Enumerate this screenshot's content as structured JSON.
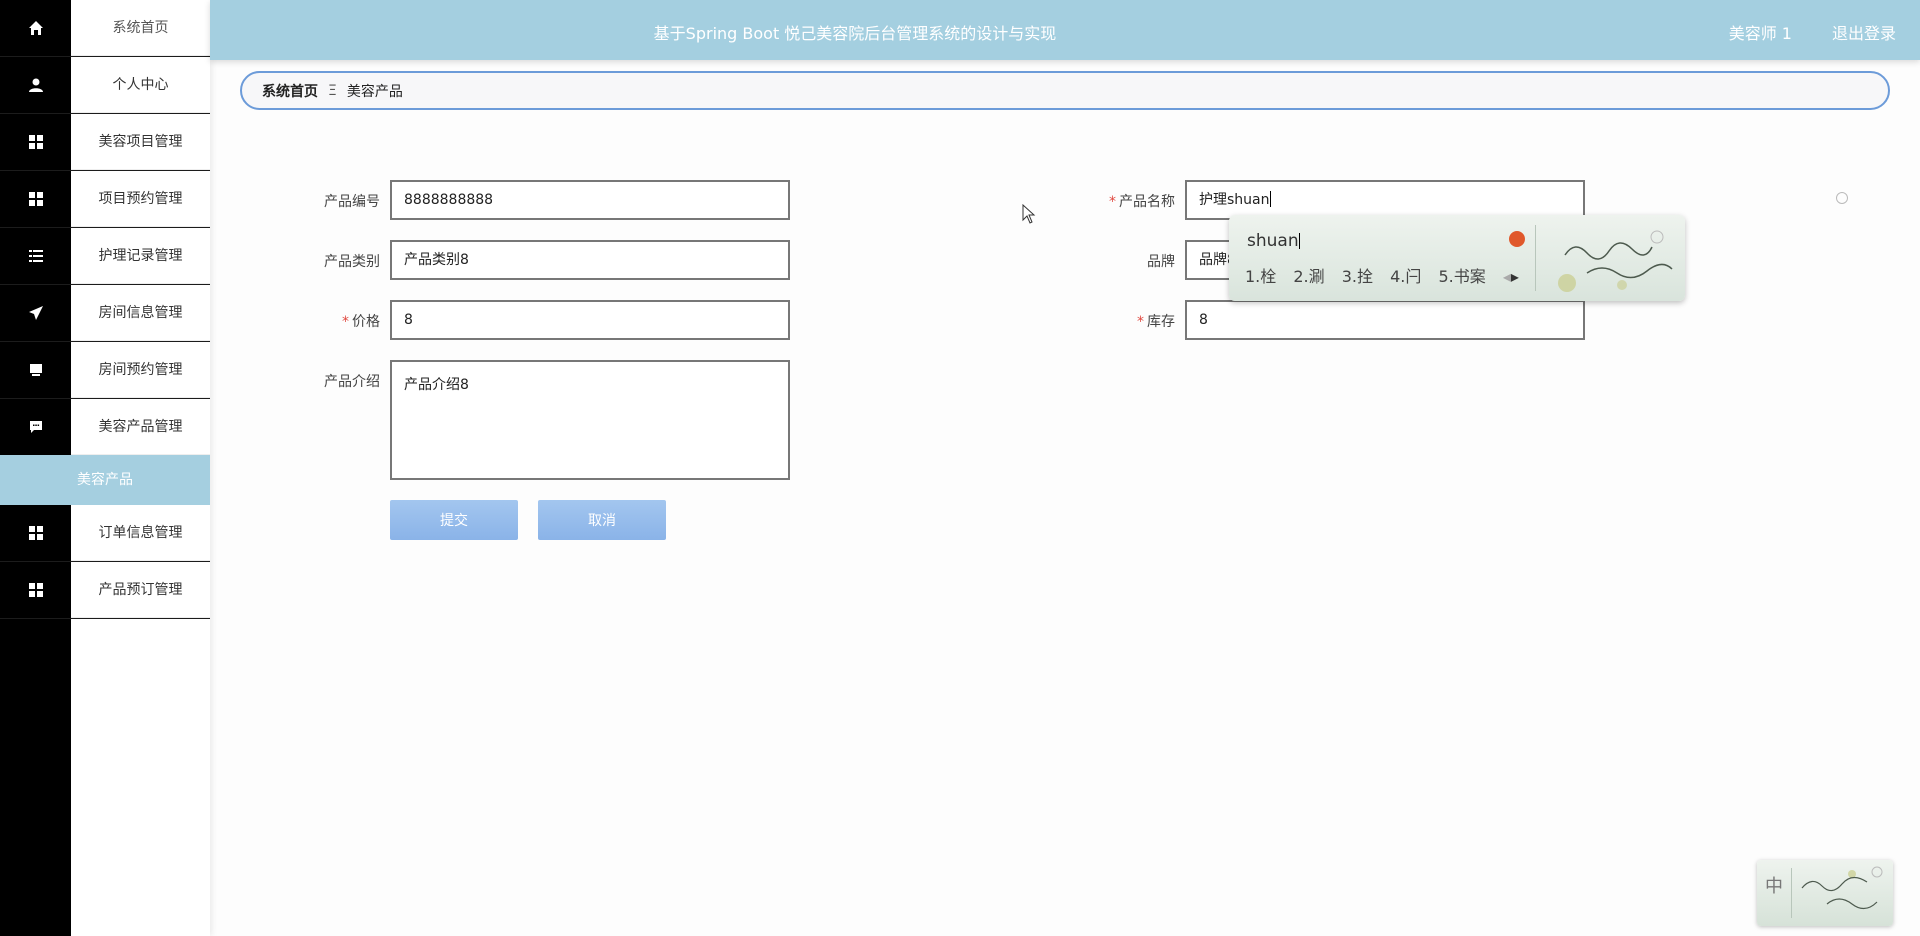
{
  "header": {
    "title": "基于Spring Boot 悦己美容院后台管理系统的设计与实现",
    "user": "美容师 1",
    "logout": "退出登录"
  },
  "sidebar": {
    "items": [
      {
        "label": "系统首页",
        "icon": "home-icon"
      },
      {
        "label": "个人中心",
        "icon": "user-icon"
      },
      {
        "label": "美容项目管理",
        "icon": "grid-icon"
      },
      {
        "label": "项目预约管理",
        "icon": "grid-icon"
      },
      {
        "label": "护理记录管理",
        "icon": "list-icon"
      },
      {
        "label": "房间信息管理",
        "icon": "send-icon"
      },
      {
        "label": "房间预约管理",
        "icon": "drive-icon"
      },
      {
        "label": "美容产品管理",
        "icon": "chat-icon"
      },
      {
        "label": "订单信息管理",
        "icon": "grid-icon"
      },
      {
        "label": "产品预订管理",
        "icon": "grid-icon"
      }
    ],
    "sub_item": "美容产品"
  },
  "breadcrumb": {
    "home": "系统首页",
    "separator": "Ξ",
    "current": "美容产品"
  },
  "form": {
    "code_label": "产品编号",
    "code_value": "8888888888",
    "category_label": "产品类别",
    "category_value": "产品类别8",
    "price_label": "价格",
    "price_value": "8",
    "intro_label": "产品介绍",
    "intro_value": "产品介绍8",
    "name_label": "产品名称",
    "name_value": "护理shuan",
    "brand_label": "品牌",
    "brand_value": "品牌8",
    "stock_label": "库存",
    "stock_value": "8",
    "required_mark": "*",
    "submit": "提交",
    "cancel": "取消"
  },
  "ime": {
    "pinyin": "shuan",
    "candidates": [
      "1.栓",
      "2.涮",
      "3.拴",
      "4.闩",
      "5.书案"
    ],
    "status": "中"
  },
  "colors": {
    "header": "#a4cfe0",
    "active_sub": "#a5cfe0",
    "button": "#8ab3e8",
    "required": "#e0483f"
  }
}
